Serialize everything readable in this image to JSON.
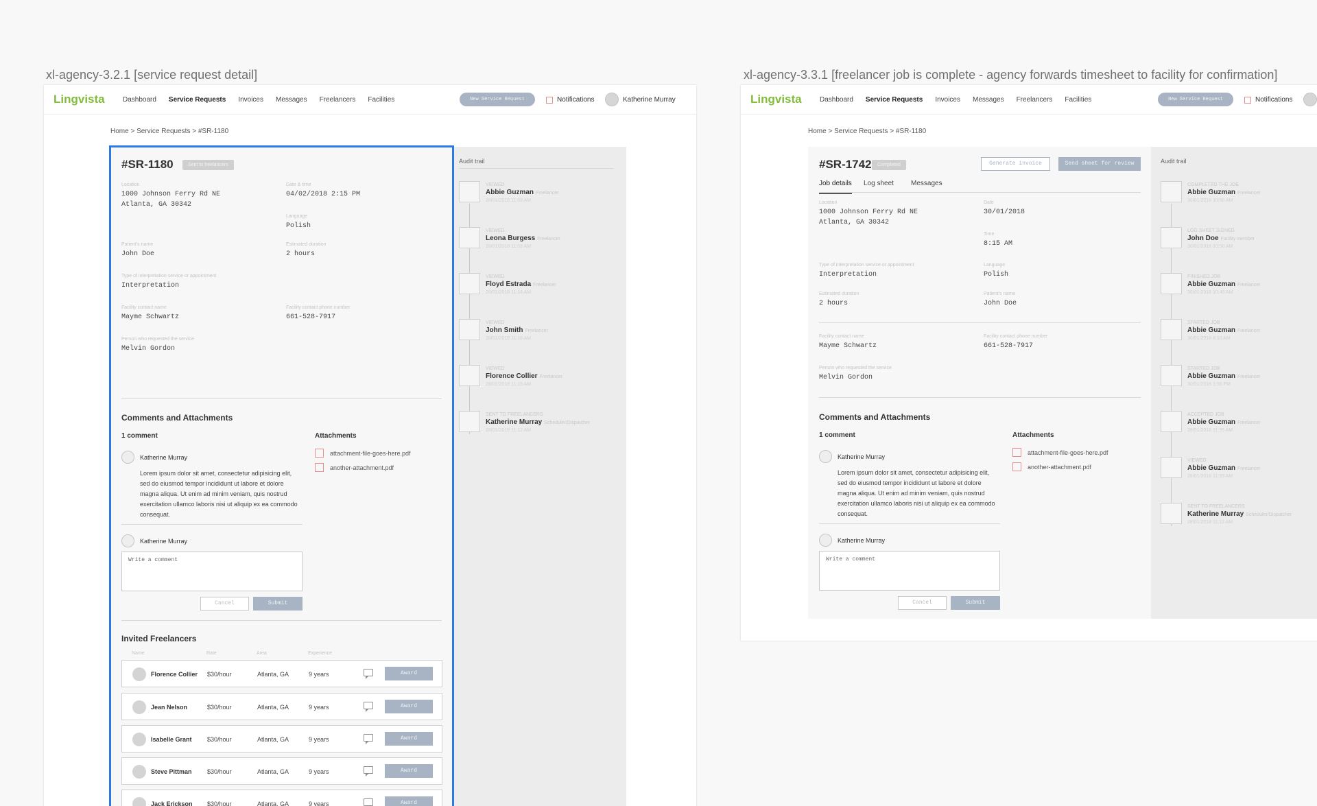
{
  "artboards": {
    "left_title": "xl-agency-3.2.1 [service request detail]",
    "right_title": "xl-agency-3.3.1 [freelancer job is complete - agency forwards timesheet to facility for confirmation]"
  },
  "colors": {
    "brand_green": "#82bc3a",
    "button_gray_blue": "#a8b4c4",
    "selection_blue": "#2c7be5",
    "checkbox_red": "#e88d8d"
  },
  "header": {
    "logo": "Lingvista",
    "nav": [
      "Dashboard",
      "Service Requests",
      "Invoices",
      "Messages",
      "Freelancers",
      "Facilities"
    ],
    "active_nav": "Service Requests",
    "new_request_label": "New Service Request",
    "notifications_label": "Notifications",
    "user_name": "Katherine Murray"
  },
  "left": {
    "breadcrumb": "Home > Service Requests > #SR-1180",
    "id": "#SR-1180",
    "status": "Sent to freelancers",
    "fields": {
      "location_label": "Location",
      "location_value": "1000 Johnson Ferry Rd NE\nAtlanta, GA 30342",
      "datetime_label": "Date & time",
      "datetime_value": "04/02/2018 2:15 PM",
      "language_label": "Language",
      "language_value": "Polish",
      "patient_label": "Patient's name",
      "patient_value": "John Doe",
      "duration_label": "Estimated duration",
      "duration_value": "2 hours",
      "type_label": "Type of interpretation service or appointment",
      "type_value": "Interpretation",
      "contact_label": "Facility contact name",
      "contact_value": "Mayme Schwartz",
      "phone_label": "Facility contact phone number",
      "phone_value": "661-528-7917",
      "requester_label": "Person who requested the service",
      "requester_value": "Melvin Gordon"
    },
    "comments_title": "Comments and Attachments",
    "comment_count": "1 comment",
    "comment_author": "Katherine Murray",
    "comment_text": "Lorem ipsum dolor sit amet, consectetur adipisicing elit, sed do eiusmod tempor incididunt ut labore et dolore magna aliqua. Ut enim ad minim veniam, quis nostrud exercitation ullamco laboris nisi ut aliquip ex ea commodo consequat.",
    "reply_author": "Katherine Murray",
    "comment_placeholder": "Write a comment",
    "cancel_label": "Cancel",
    "submit_label": "Submit",
    "attachments_title": "Attachments",
    "attachments": [
      "attachment-file-goes-here.pdf",
      "another-attachment.pdf"
    ],
    "invited_title": "Invited Freelancers",
    "table_headers": [
      "Name",
      "Rate",
      "Area",
      "Experience"
    ],
    "award_label": "Award",
    "freelancers": [
      {
        "name": "Florence Collier",
        "rate": "$30/hour",
        "area": "Atlanta, GA",
        "experience": "9 years"
      },
      {
        "name": "Jean Nelson",
        "rate": "$30/hour",
        "area": "Atlanta, GA",
        "experience": "9 years"
      },
      {
        "name": "Isabelle Grant",
        "rate": "$30/hour",
        "area": "Atlanta, GA",
        "experience": "9 years"
      },
      {
        "name": "Steve Pittman",
        "rate": "$30/hour",
        "area": "Atlanta, GA",
        "experience": "9 years"
      },
      {
        "name": "Jack Erickson",
        "rate": "$30/hour",
        "area": "Atlanta, GA",
        "experience": "9 years"
      }
    ],
    "audit_title": "Audit trail",
    "audit": [
      {
        "action": "Viewed",
        "name": "Abbie Guzman",
        "role": "Freelancer",
        "date": "28/01/2018 11:03 AM"
      },
      {
        "action": "Viewed",
        "name": "Leona Burgess",
        "role": "Freelancer",
        "date": "28/01/2018 11:03 AM"
      },
      {
        "action": "Viewed",
        "name": "Floyd Estrada",
        "role": "Freelancer",
        "date": "28/01/2018 11:18 AM"
      },
      {
        "action": "Viewed",
        "name": "John Smith",
        "role": "Freelancer",
        "date": "28/01/2018 11:16 AM"
      },
      {
        "action": "Viewed",
        "name": "Florence Collier",
        "role": "Freelancer",
        "date": "28/01/2018 11:15 AM"
      },
      {
        "action": "Sent to freelancers",
        "name": "Katherine Murray",
        "role": "Scheduler/Dispatcher",
        "date": "28/01/2018 11:12 AM"
      }
    ]
  },
  "right": {
    "breadcrumb": "Home > Service Requests > #SR-1180",
    "id": "#SR-1742",
    "status": "Completed",
    "generate_invoice_label": "Generate invoice",
    "send_sheet_label": "Send sheet for review",
    "tabs": [
      "Job details",
      "Log sheet",
      "Messages"
    ],
    "fields": {
      "location_label": "Location",
      "location_value": "1000 Johnson Ferry Rd NE\nAtlanta, GA 30342",
      "date_label": "Date",
      "date_value": "30/01/2018",
      "time_label": "Time",
      "time_value": "8:15 AM",
      "type_label": "Type of interpretation service or appointment",
      "type_value": "Interpretation",
      "language_label": "Language",
      "language_value": "Polish",
      "duration_label": "Estimated duration",
      "duration_value": "2 hours",
      "patient_label": "Patient's name",
      "patient_value": "John Doe",
      "contact_label": "Facility contact name",
      "contact_value": "Mayme Schwartz",
      "phone_label": "Facility contact phone number",
      "phone_value": "661-528-7917",
      "requester_label": "Person who requested the service",
      "requester_value": "Melvin Gordon"
    },
    "comments_title": "Comments and Attachments",
    "comment_count": "1 comment",
    "comment_author": "Katherine Murray",
    "comment_text": "Lorem ipsum dolor sit amet, consectetur adipisicing elit, sed do eiusmod tempor incididunt ut labore et dolore magna aliqua. Ut enim ad minim veniam, quis nostrud exercitation ullamco laboris nisi ut aliquip ex ea commodo consequat.",
    "reply_author": "Katherine Murray",
    "comment_placeholder": "Write a comment",
    "cancel_label": "Cancel",
    "submit_label": "Submit",
    "attachments_title": "Attachments",
    "attachments": [
      "attachment-file-goes-here.pdf",
      "another-attachment.pdf"
    ],
    "audit_title": "Audit trail",
    "audit": [
      {
        "action": "Completed the job",
        "name": "Abbie Guzman",
        "role": "Freelancer",
        "date": "30/01/2018 10:50 AM"
      },
      {
        "action": "Log sheet signed",
        "name": "John Doe",
        "role": "Facility member",
        "date": "30/01/2018 10:50 AM"
      },
      {
        "action": "Finished job",
        "name": "Abbie Guzman",
        "role": "Freelancer",
        "date": "30/01/2018 10:49 AM"
      },
      {
        "action": "Started job",
        "name": "Abbie Guzman",
        "role": "Freelancer",
        "date": "30/01/2018 8:10 AM"
      },
      {
        "action": "Started job",
        "name": "Abbie Guzman",
        "role": "Freelancer",
        "date": "30/01/2018 3:55 PM"
      },
      {
        "action": "Accepted job",
        "name": "Abbie Guzman",
        "role": "Freelancer",
        "date": "28/01/2018 11:35 AM"
      },
      {
        "action": "Viewed",
        "name": "Abbie Guzman",
        "role": "Freelancer",
        "date": "28/01/2018 11:33 AM"
      },
      {
        "action": "Sent to freelancers",
        "name": "Katherine Murray",
        "role": "Scheduler/Dispatcher",
        "date": "28/01/2018 11:12 AM"
      }
    ]
  }
}
